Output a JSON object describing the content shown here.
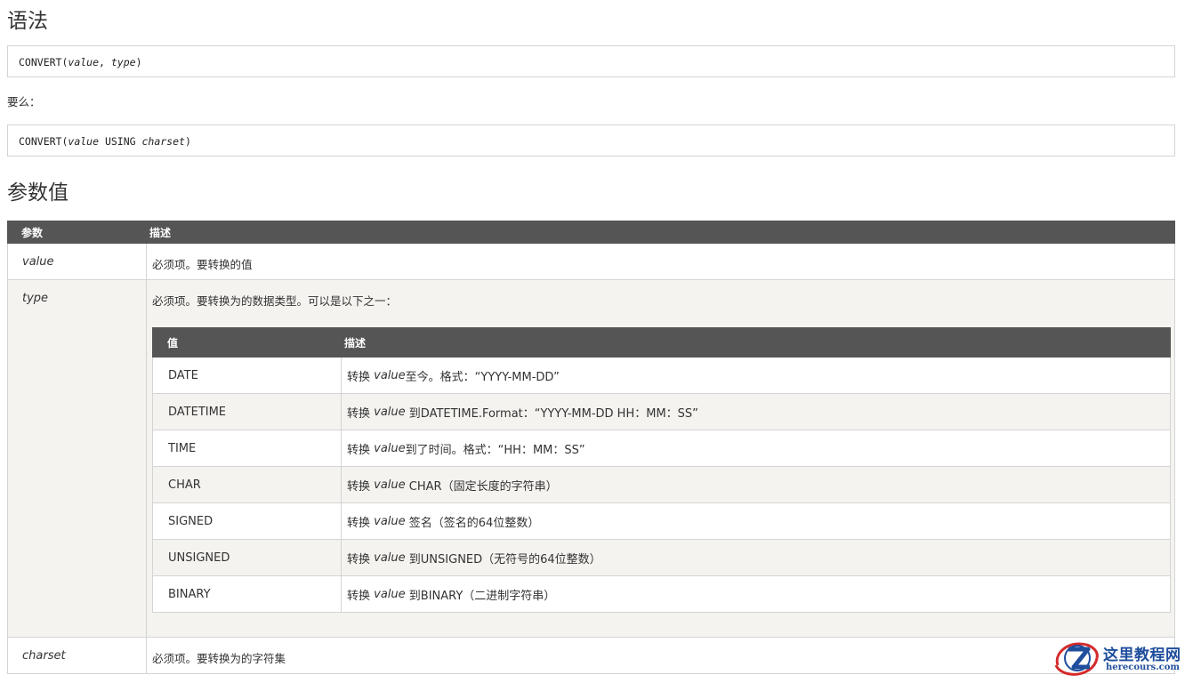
{
  "syntax": {
    "heading": "语法",
    "code1": {
      "fn": "CONVERT(",
      "a1": "value",
      "sep": ", ",
      "a2": "type",
      "end": ")"
    },
    "or_text": "要么：",
    "code2": {
      "fn": "CONVERT(",
      "a1": "value",
      "mid": " USING ",
      "a2": "charset",
      "end": ")"
    }
  },
  "params": {
    "heading": "参数值",
    "headers": {
      "param": "参数",
      "desc": "描述"
    },
    "rows": [
      {
        "name": "value",
        "desc": "必须项。要转换的值"
      },
      {
        "name": "type",
        "desc": "必须项。要转换为的数据类型。可以是以下之一："
      },
      {
        "name": "charset",
        "desc": "必须项。要转换为的字符集"
      }
    ],
    "type_table": {
      "headers": {
        "value": "值",
        "desc": "描述"
      },
      "rows": [
        {
          "value": "DATE",
          "pre": "转换 ",
          "em": "value",
          "post": "至今。格式：“YYYY-MM-DD”"
        },
        {
          "value": "DATETIME",
          "pre": "转换 ",
          "em": "value",
          "post": " 到DATETIME.Format：“YYYY-MM-DD HH：MM：SS”"
        },
        {
          "value": "TIME",
          "pre": "转换 ",
          "em": "value",
          "post": "到了时间。格式：“HH：MM：SS”"
        },
        {
          "value": "CHAR",
          "pre": "转换 ",
          "em": "value",
          "post": " CHAR（固定长度的字符串）"
        },
        {
          "value": "SIGNED",
          "pre": "转换 ",
          "em": "value",
          "post": " 签名（签名的64位整数）"
        },
        {
          "value": "UNSIGNED",
          "pre": "转换 ",
          "em": "value",
          "post": " 到UNSIGNED（无符号的64位整数）"
        },
        {
          "value": "BINARY",
          "pre": "转换 ",
          "em": "value",
          "post": " 到BINARY（二进制字符串）"
        }
      ]
    }
  },
  "logo": {
    "title": "这里教程网",
    "subtitle": "herecours.com",
    "colors": {
      "blue": "#1f4e9c",
      "red": "#d42a2a"
    }
  }
}
